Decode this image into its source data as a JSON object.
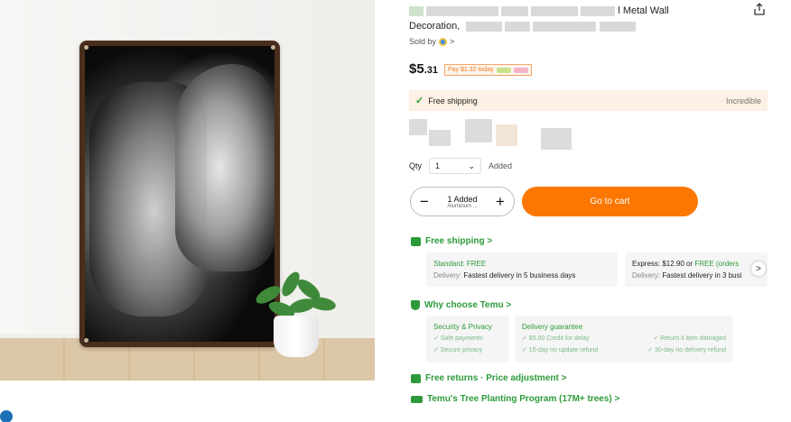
{
  "product": {
    "title_suffix": "l Metal Wall",
    "title_line2": "Decoration,",
    "sold_by_label": "Sold by",
    "sold_by_chevron": ">",
    "price_main": "$5",
    "price_cents": ".31",
    "pay_today": "Pay $1.32 today"
  },
  "shipping_bar": {
    "check_icon": "check-icon",
    "label": "Free shipping",
    "right_text": "Incredible"
  },
  "quantity": {
    "label": "Qty",
    "value": "1",
    "added": "Added"
  },
  "stepper": {
    "minus": "−",
    "plus": "+",
    "line1": "1 Added",
    "line2": "Aluminum ..."
  },
  "cart_button": "Go to cart",
  "free_shipping_section": {
    "title": "Free shipping >",
    "icon": "truck-icon",
    "standard": {
      "title": "Standard: FREE",
      "delivery_label": "Delivery:",
      "delivery_text": "Fastest delivery in 5 business days"
    },
    "express": {
      "title_prefix": "Express: $12.90 or",
      "title_free": "FREE (orders",
      "delivery_label": "Delivery:",
      "delivery_text": "Fastest delivery in 3 busi"
    },
    "arrow": ">"
  },
  "why_section": {
    "title": "Why choose Temu >",
    "icon": "shield-icon",
    "security": {
      "title": "Security & Privacy",
      "items": [
        "✓ Safe payments",
        "✓ Secure privacy"
      ]
    },
    "delivery": {
      "title": "Delivery guarantee",
      "items": [
        "✓ $5.00 Credit for delay",
        "✓ Return if item damaged",
        "✓ 15-day no update refund",
        "✓ 30-day no delivery refund"
      ]
    }
  },
  "returns": {
    "icon": "returns-icon",
    "label": "Free returns · Price adjustment >"
  },
  "tree_program": {
    "icon": "tree-icon",
    "label": "Temu's Tree Planting Program (17M+ trees) >"
  },
  "colors": {
    "accent_orange": "#fb7701",
    "green": "#2c9a3a",
    "ship_bar_bg": "#fdf0e4"
  }
}
